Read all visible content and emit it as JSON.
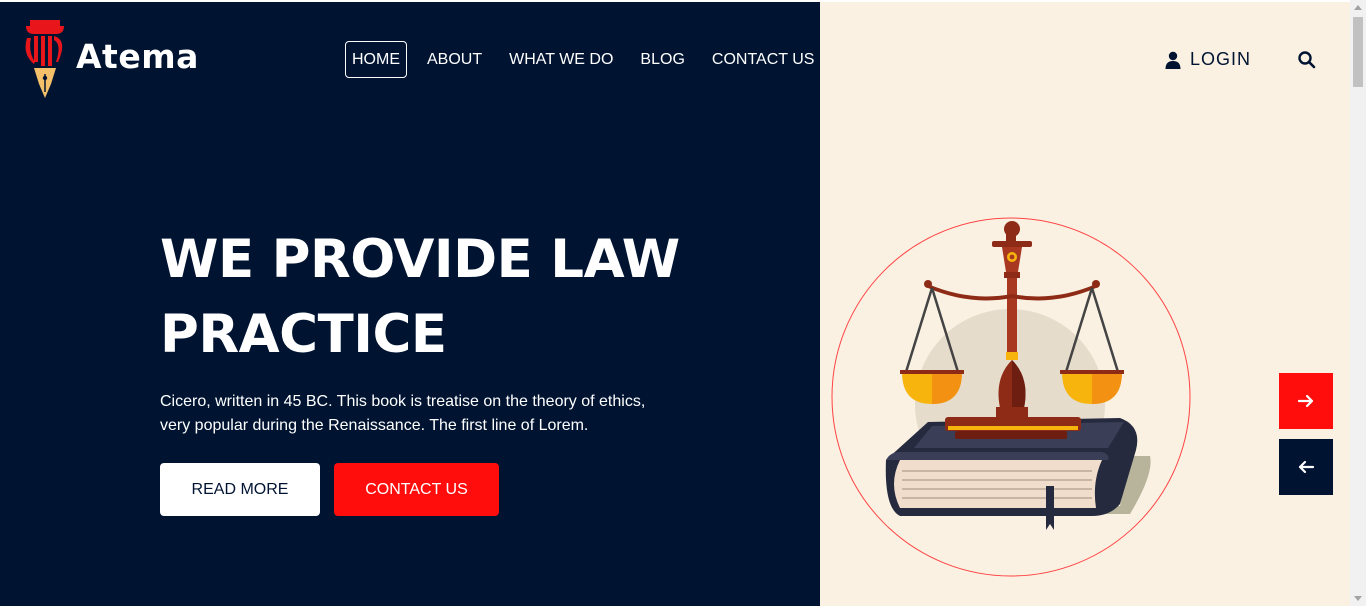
{
  "brand": {
    "name": "Atema",
    "logo_icon": "pillar-pen-logo"
  },
  "nav": {
    "items": [
      {
        "label": "HOME",
        "active": true
      },
      {
        "label": "ABOUT",
        "active": false
      },
      {
        "label": "WHAT WE DO",
        "active": false
      },
      {
        "label": "BLOG",
        "active": false
      },
      {
        "label": "CONTACT US",
        "active": false
      }
    ]
  },
  "header": {
    "login_label": "LOGIN",
    "login_icon": "user-icon",
    "search_icon": "search-icon"
  },
  "hero": {
    "title_line1": "WE PROVIDE LAW",
    "title_line2": "PRACTICE",
    "description_line1": "Cicero, written in 45 BC. This book is treatise on the theory of ethics,",
    "description_line2": "very popular during the Renaissance. The first line of Lorem.",
    "read_more_label": "READ MORE",
    "contact_label": "CONTACT US",
    "illustration": "scales-of-justice-on-book"
  },
  "slider": {
    "next_icon": "arrow-right-icon",
    "prev_icon": "arrow-left-icon"
  },
  "colors": {
    "navy": "#001432",
    "accent_red": "#ff0d0d",
    "cream": "#faf1e2",
    "white": "#ffffff"
  }
}
